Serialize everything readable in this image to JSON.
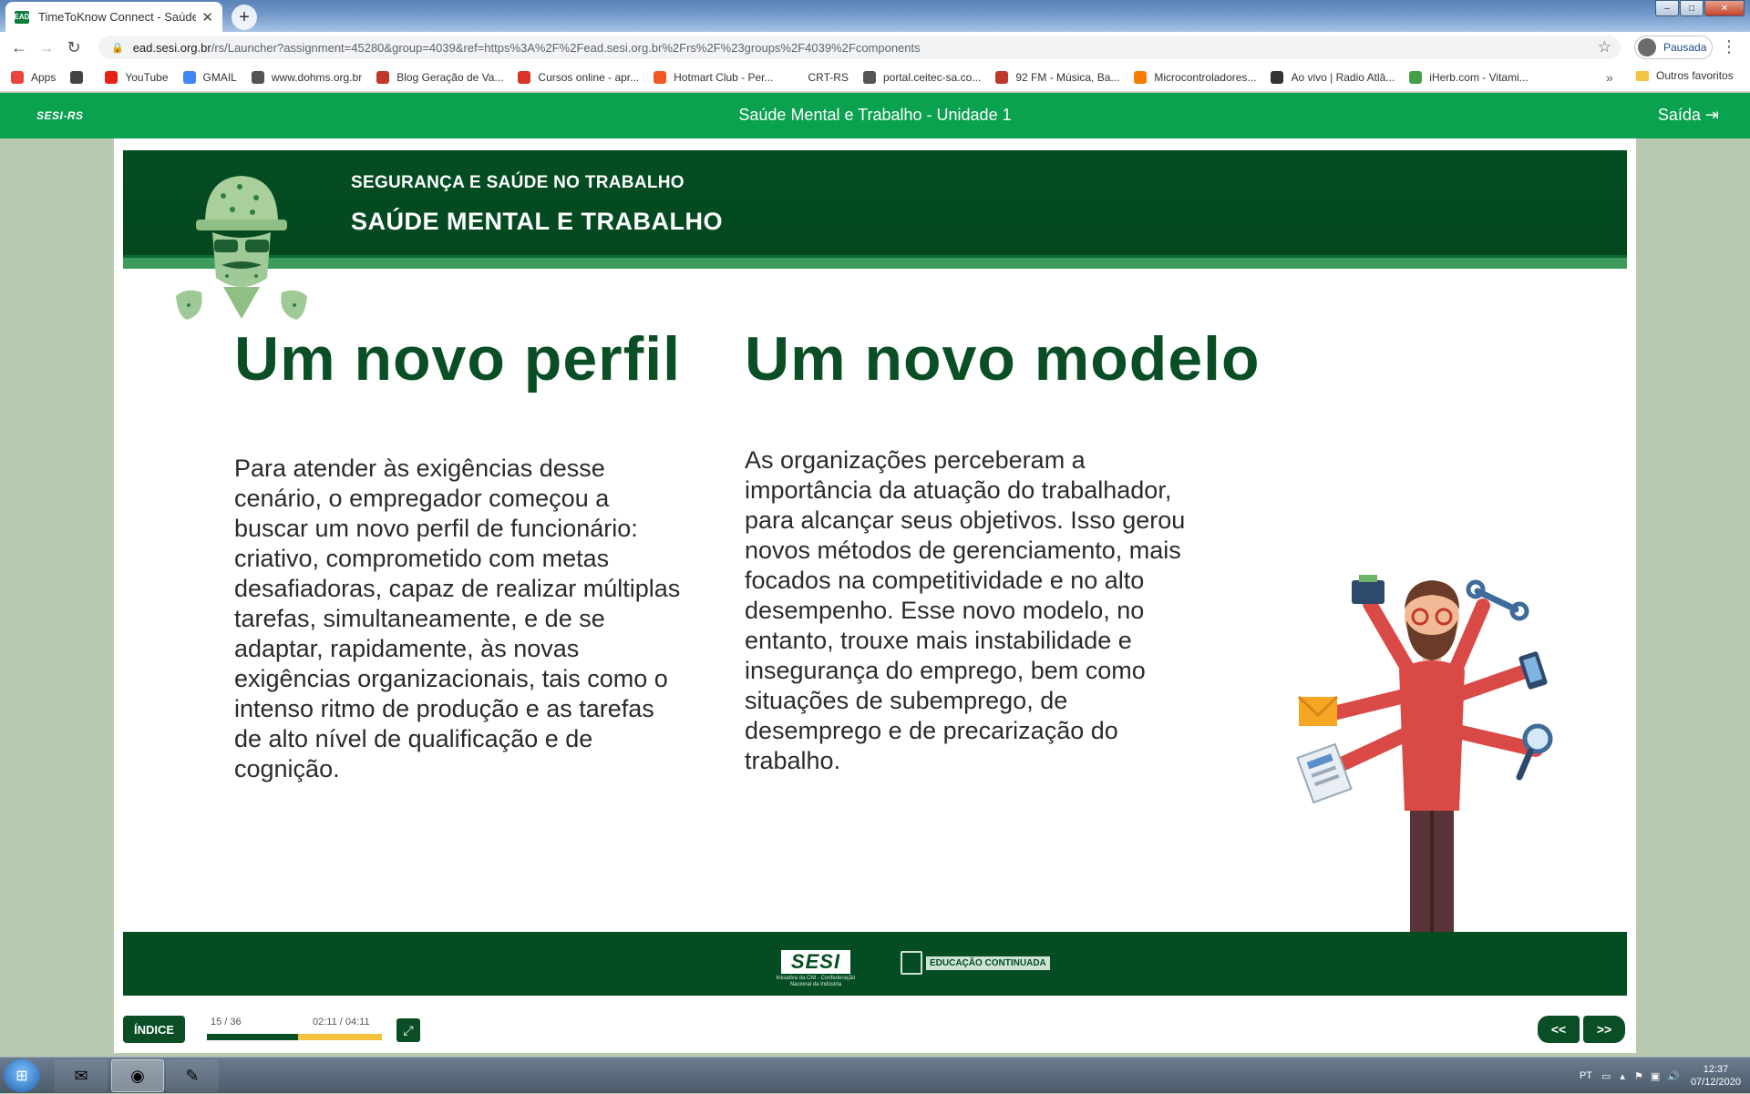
{
  "browser": {
    "tab_title": "TimeToKnow Connect - Saúde M",
    "tab_favicon_text": "EAD",
    "url_host": "ead.sesi.org.br",
    "url_path": "/rs/Launcher?assignment=45280&group=4039&ref=https%3A%2F%2Fead.sesi.org.br%2Frs%2F%23groups%2F4039%2Fcomponents",
    "profile_label": "Pausada",
    "bookmarks": [
      {
        "label": "Apps",
        "color": "#e8453c"
      },
      {
        "label": "",
        "color": "#444444"
      },
      {
        "label": "YouTube",
        "color": "#e62117"
      },
      {
        "label": "GMAIL",
        "color": "#4285f4"
      },
      {
        "label": "www.dohms.org.br",
        "color": "#555555"
      },
      {
        "label": "Blog Geração de Va...",
        "color": "#c0392b"
      },
      {
        "label": "Cursos online - apr...",
        "color": "#d9332a"
      },
      {
        "label": "Hotmart Club - Per...",
        "color": "#f05a22"
      },
      {
        "label": "CRT-RS",
        "color": "#ffffff"
      },
      {
        "label": "portal.ceitec-sa.co...",
        "color": "#555555"
      },
      {
        "label": "92 FM - Música, Ba...",
        "color": "#c0392b"
      },
      {
        "label": "Microcontroladores...",
        "color": "#f57c00"
      },
      {
        "label": "Ao vivo | Radio Atlâ...",
        "color": "#333333"
      },
      {
        "label": "iHerb.com - Vitami...",
        "color": "#43a047"
      }
    ],
    "bookmarks_more": "»",
    "bookmarks_other": "Outros favoritos"
  },
  "app": {
    "brand": "SESI-RS",
    "course_title": "Saúde Mental e Trabalho - Unidade 1",
    "exit_label": "Saída"
  },
  "slide": {
    "banner_sup": "SEGURANÇA E SAÚDE NO TRABALHO",
    "banner_main": "SAÚDE MENTAL E TRABALHO",
    "heading_left": "Um novo perfil",
    "heading_right": "Um novo modelo",
    "text_left": "Para atender às exigências desse cenário, o empregador começou a buscar um novo perfil de funcionário: criativo, comprometido com metas desafiadoras, capaz de realizar múltiplas tarefas, simultaneamente, e de se adaptar, rapidamente, às novas exigências organizacionais, tais como o intenso ritmo de produção e as tarefas de alto nível de qualificação e de cognição.",
    "text_right": "As organizações perceberam a importância da atuação do trabalhador, para alcançar seus objetivos. Isso gerou novos métodos de gerenciamento, mais focados na competitividade e no alto desempenho. Esse novo modelo, no entanto, trouxe mais instabilidade e insegurança do emprego, bem como situações de subemprego, de desemprego e de precarização do trabalho.",
    "footer_logo_sesi": "SESI",
    "footer_logo_sesi_sub": "Iniciativa da CNI - Confederação Nacional da Indústria",
    "footer_logo_edu": "EDUCAÇÃO CONTINUADA"
  },
  "player": {
    "index_label": "ÍNDICE",
    "page_info": "15 / 36",
    "time_info": "02:11 / 04:11",
    "progress_fraction": 0.52,
    "prev_label": "<<",
    "next_label": ">>"
  },
  "taskbar": {
    "language": "PT",
    "time": "12:37",
    "date": "07/12/2020"
  }
}
